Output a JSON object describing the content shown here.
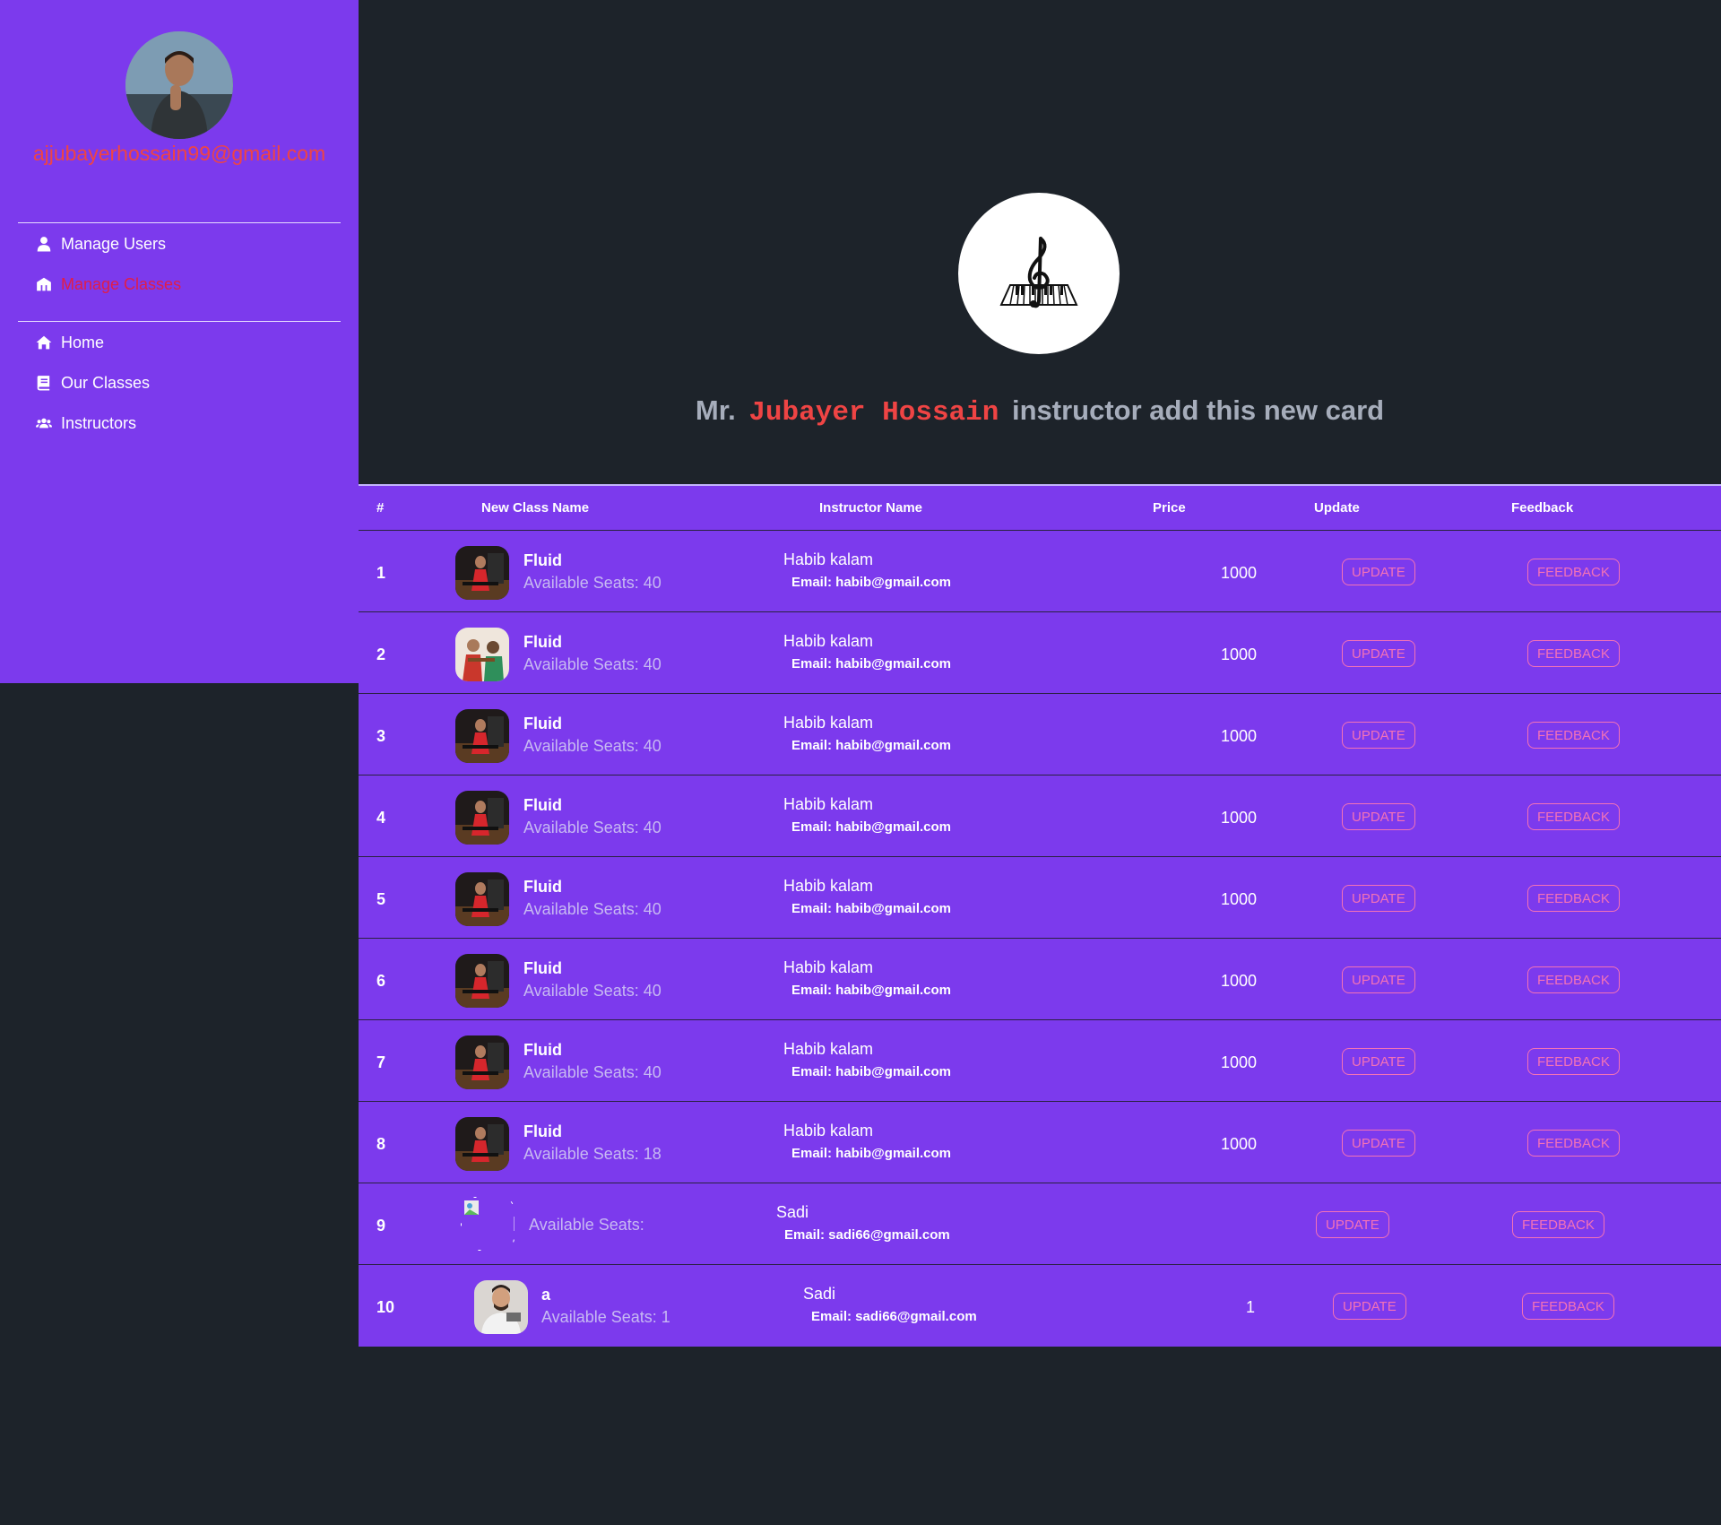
{
  "sidebar": {
    "user_email": "ajjubayerhossain99@gmail.com",
    "admin_items": [
      {
        "label": "Manage Users",
        "icon": "user-icon",
        "active": false
      },
      {
        "label": "Manage Classes",
        "icon": "classes-icon",
        "active": true
      }
    ],
    "site_items": [
      {
        "label": "Home",
        "icon": "home-icon"
      },
      {
        "label": "Our Classes",
        "icon": "book-icon"
      },
      {
        "label": "Instructors",
        "icon": "users-icon"
      }
    ]
  },
  "header": {
    "prefix": "Mr.",
    "instructor_name": "Jubayer Hossain",
    "suffix": "instructor add this new card"
  },
  "table": {
    "headers": [
      "#",
      "New Class Name",
      "Instructor Name",
      "Price",
      "Update",
      "Feedback"
    ],
    "update_label": "UPDATE",
    "feedback_label": "FEEDBACK",
    "rows": [
      {
        "num": "1",
        "name": "Fluid",
        "seats": "Available Seats: 40",
        "instructor": "Habib kalam",
        "email": "Email: habib@gmail.com",
        "price": "1000"
      },
      {
        "num": "2",
        "name": "Fluid",
        "seats": "Available Seats: 40",
        "instructor": "Habib kalam",
        "email": "Email: habib@gmail.com",
        "price": "1000"
      },
      {
        "num": "3",
        "name": "Fluid",
        "seats": "Available Seats: 40",
        "instructor": "Habib kalam",
        "email": "Email: habib@gmail.com",
        "price": "1000"
      },
      {
        "num": "4",
        "name": "Fluid",
        "seats": "Available Seats: 40",
        "instructor": "Habib kalam",
        "email": "Email: habib@gmail.com",
        "price": "1000"
      },
      {
        "num": "5",
        "name": "Fluid",
        "seats": "Available Seats: 40",
        "instructor": "Habib kalam",
        "email": "Email: habib@gmail.com",
        "price": "1000"
      },
      {
        "num": "6",
        "name": "Fluid",
        "seats": "Available Seats: 40",
        "instructor": "Habib kalam",
        "email": "Email: habib@gmail.com",
        "price": "1000"
      },
      {
        "num": "7",
        "name": "Fluid",
        "seats": "Available Seats: 40",
        "instructor": "Habib kalam",
        "email": "Email: habib@gmail.com",
        "price": "1000"
      },
      {
        "num": "8",
        "name": "Fluid",
        "seats": "Available Seats: 18",
        "instructor": "Habib kalam",
        "email": "Email: habib@gmail.com",
        "price": "1000"
      },
      {
        "num": "9",
        "name": "",
        "seats": "Available Seats:",
        "instructor": "Sadi",
        "email": "Email: sadi66@gmail.com",
        "price": ""
      },
      {
        "num": "10",
        "name": "a",
        "seats": "Available Seats: 1",
        "instructor": "Sadi",
        "email": "Email: sadi66@gmail.com",
        "price": "1"
      }
    ]
  }
}
